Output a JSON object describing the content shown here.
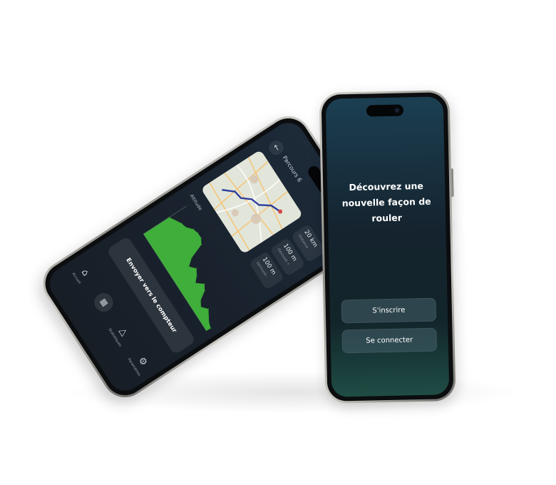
{
  "onboarding": {
    "headline": "Découvrez une nouvelle façon de rouler",
    "signup_label": "S'inscrire",
    "login_label": "Se connecter",
    "accent": "#1b3f52"
  },
  "route": {
    "title": "Parcours 6",
    "stats": [
      {
        "value": "20 km",
        "sub": "Distance"
      },
      {
        "value": "100 m",
        "sub": "Dénivelé +"
      },
      {
        "value": "100 m",
        "sub": "Dénivelé -"
      }
    ],
    "altitude_label": "Altitude",
    "send_label": "Envoyer vers le compteur",
    "chart_color": "#3fae3a"
  },
  "nav": {
    "items": [
      {
        "label": "Accueil",
        "icon": "home-icon"
      },
      {
        "label": "",
        "icon": "map-icon"
      },
      {
        "label": "Statistiques",
        "icon": "rider-icon"
      },
      {
        "label": "Paramètres",
        "icon": "gear-icon"
      }
    ]
  },
  "chart_data": {
    "type": "area",
    "ylabel": "Altitude",
    "x": [
      0,
      1,
      2,
      3,
      4,
      5,
      6,
      7,
      8,
      9,
      10,
      11,
      12,
      13,
      14,
      15,
      16,
      17,
      18,
      19,
      20
    ],
    "values": [
      18,
      20,
      22,
      23,
      26,
      27,
      27,
      25,
      16,
      12,
      15,
      13,
      10,
      14,
      12,
      7,
      5,
      8,
      6,
      4,
      3
    ]
  }
}
